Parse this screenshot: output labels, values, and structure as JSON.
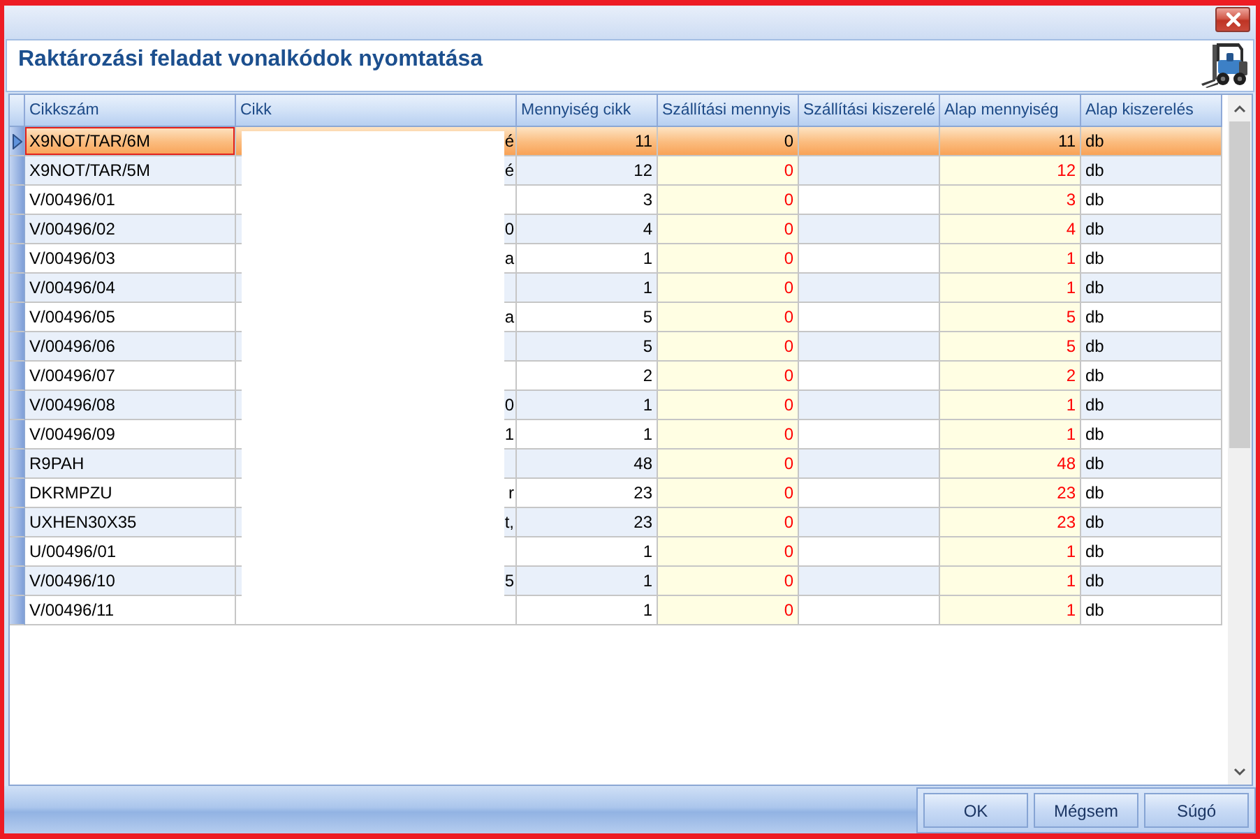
{
  "header": {
    "title": "Raktározási feladat vonalkódok nyomtatása"
  },
  "table": {
    "columns": [
      "Cikkszám",
      "Cikk",
      "Mennyiség cikk",
      "Szállítási mennyis",
      "Szállítási kiszerelé",
      "Alap mennyiség",
      "Alap kiszerelés"
    ],
    "rows": [
      {
        "selected": true,
        "cikkszam": "X9NOT/TAR/6M",
        "cikk": "é",
        "mennyiseg": "11",
        "szallitasi_mennyiseg": "0",
        "alap_mennyiseg": "11",
        "alap_kiszereles": "db"
      },
      {
        "selected": false,
        "cikkszam": "X9NOT/TAR/5M",
        "cikk": "é",
        "mennyiseg": "12",
        "szallitasi_mennyiseg": "0",
        "alap_mennyiseg": "12",
        "alap_kiszereles": "db"
      },
      {
        "selected": false,
        "cikkszam": "V/00496/01",
        "mennyiseg": "3",
        "szallitasi_mennyiseg": "0",
        "alap_mennyiseg": "3",
        "alap_kiszereles": "db"
      },
      {
        "selected": false,
        "cikkszam": "V/00496/02",
        "cikk": "0",
        "mennyiseg": "4",
        "szallitasi_mennyiseg": "0",
        "alap_mennyiseg": "4",
        "alap_kiszereles": "db"
      },
      {
        "selected": false,
        "cikkszam": "V/00496/03",
        "cikk": "a",
        "mennyiseg": "1",
        "szallitasi_mennyiseg": "0",
        "alap_mennyiseg": "1",
        "alap_kiszereles": "db"
      },
      {
        "selected": false,
        "cikkszam": "V/00496/04",
        "mennyiseg": "1",
        "szallitasi_mennyiseg": "0",
        "alap_mennyiseg": "1",
        "alap_kiszereles": "db"
      },
      {
        "selected": false,
        "cikkszam": "V/00496/05",
        "cikk": "a",
        "mennyiseg": "5",
        "szallitasi_mennyiseg": "0",
        "alap_mennyiseg": "5",
        "alap_kiszereles": "db"
      },
      {
        "selected": false,
        "cikkszam": "V/00496/06",
        "mennyiseg": "5",
        "szallitasi_mennyiseg": "0",
        "alap_mennyiseg": "5",
        "alap_kiszereles": "db"
      },
      {
        "selected": false,
        "cikkszam": "V/00496/07",
        "mennyiseg": "2",
        "szallitasi_mennyiseg": "0",
        "alap_mennyiseg": "2",
        "alap_kiszereles": "db"
      },
      {
        "selected": false,
        "cikkszam": "V/00496/08",
        "cikk": "0",
        "mennyiseg": "1",
        "szallitasi_mennyiseg": "0",
        "alap_mennyiseg": "1",
        "alap_kiszereles": "db"
      },
      {
        "selected": false,
        "cikkszam": "V/00496/09",
        "cikk": "1",
        "mennyiseg": "1",
        "szallitasi_mennyiseg": "0",
        "alap_mennyiseg": "1",
        "alap_kiszereles": "db"
      },
      {
        "selected": false,
        "cikkszam": "R9PAH",
        "mennyiseg": "48",
        "szallitasi_mennyiseg": "0",
        "alap_mennyiseg": "48",
        "alap_kiszereles": "db"
      },
      {
        "selected": false,
        "cikkszam": "DKRMPZU",
        "cikk": "r",
        "mennyiseg": "23",
        "szallitasi_mennyiseg": "0",
        "alap_mennyiseg": "23",
        "alap_kiszereles": "db"
      },
      {
        "selected": false,
        "cikkszam": "UXHEN30X35",
        "cikk": "t,",
        "mennyiseg": "23",
        "szallitasi_mennyiseg": "0",
        "alap_mennyiseg": "23",
        "alap_kiszereles": "db"
      },
      {
        "selected": false,
        "cikkszam": "U/00496/01",
        "mennyiseg": "1",
        "szallitasi_mennyiseg": "0",
        "alap_mennyiseg": "1",
        "alap_kiszereles": "db"
      },
      {
        "selected": false,
        "cikkszam": "V/00496/10",
        "cikk": "5",
        "mennyiseg": "1",
        "szallitasi_mennyiseg": "0",
        "alap_mennyiseg": "1",
        "alap_kiszereles": "db"
      },
      {
        "selected": false,
        "cikkszam": "V/00496/11",
        "mennyiseg": "1",
        "szallitasi_mennyiseg": "0",
        "alap_mennyiseg": "1",
        "alap_kiszereles": "db"
      }
    ]
  },
  "buttons": [
    "OK",
    "Mégsem",
    "Súgó"
  ]
}
